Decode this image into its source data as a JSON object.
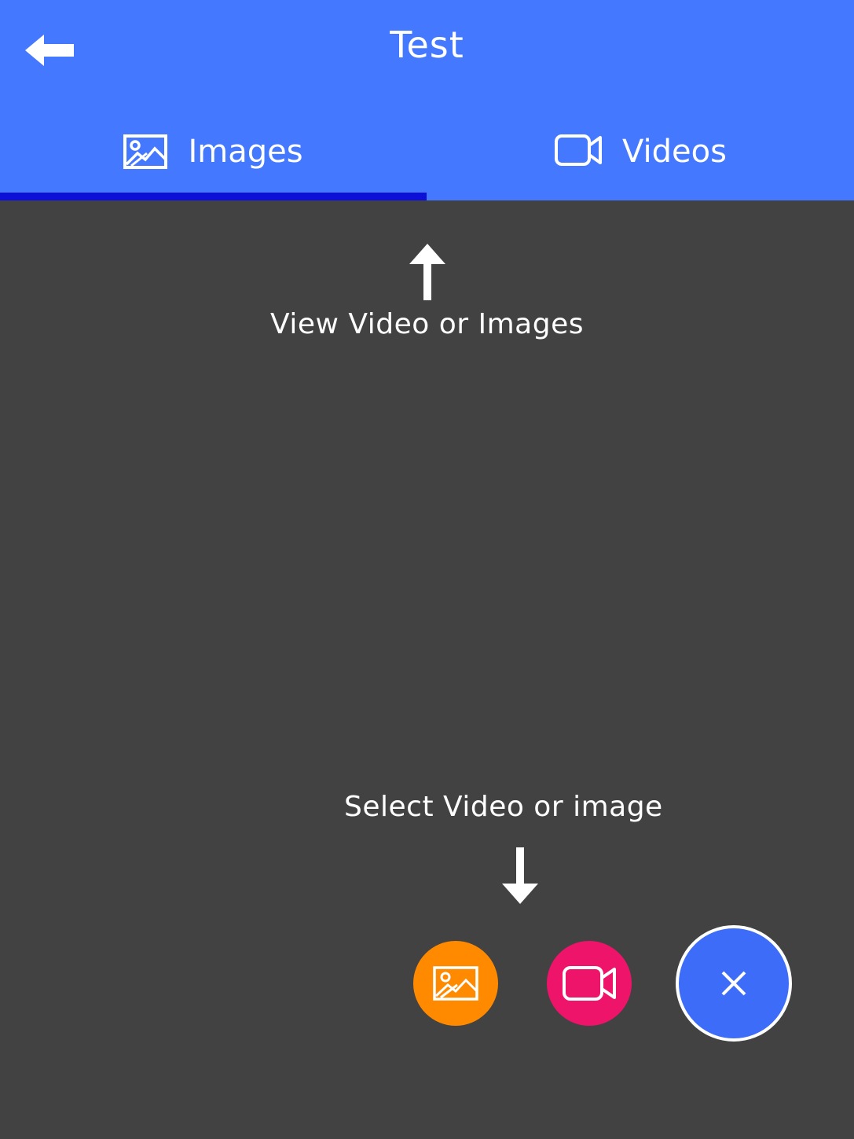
{
  "appbar": {
    "title": "Test",
    "back_icon": "arrow-left-icon",
    "color": "#4479FF"
  },
  "tabs": [
    {
      "label": "Images",
      "icon": "image-icon",
      "selected": true
    },
    {
      "label": "Videos",
      "icon": "video-camera-icon",
      "selected": false
    }
  ],
  "tab_indicator_color": "#0D10D6",
  "hints": {
    "top_text": "View Video or Images",
    "bottom_text": "Select Video or image"
  },
  "fab": {
    "image_button": {
      "icon": "image-icon",
      "color": "#FF8A00"
    },
    "video_button": {
      "icon": "video-camera-icon",
      "color": "#EE1469"
    },
    "main_button": {
      "icon": "close-icon",
      "color": "#3C6CF8"
    }
  },
  "background_color": "#424242"
}
